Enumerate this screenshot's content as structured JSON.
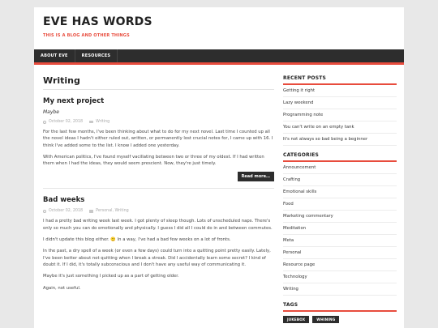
{
  "site": {
    "title": "EVE HAS WORDS",
    "description": "THIS IS A BLOG AND OTHER THINGS"
  },
  "nav": {
    "items": [
      {
        "label": "ABOUT EVE"
      },
      {
        "label": "RESOURCES"
      }
    ]
  },
  "main": {
    "page_title": "Writing",
    "posts": [
      {
        "title": "My next project",
        "subtitle": "Maybe",
        "date": "October 02, 2018",
        "category": "Writing",
        "paragraphs": [
          "For the last few months, I've been thinking about what to do for my next novel. Last time I counted up all the novel ideas I hadn't either ruled out, written, or permanently lost crucial notes for, I came up with 16. I think I've added some to the list. I know I added one yesterday.",
          "With American politics, I've found myself vacillating between two or three of my oldest. If I had written them when I had the ideas, they would seem prescient. Now, they're just timely."
        ],
        "read_more": "Read more…"
      },
      {
        "title": "Bad weeks",
        "date": "October 02, 2018",
        "category": "Personal, Writing",
        "paragraphs": [
          "I had a pretty bad writing week last week. I got plenty of sleep though. Lots of unscheduled naps. There's only so much you can do emotionally and physically. I guess I did all I could do in and between commutes.",
          "I didn't update this blog either. 🙁 In a way, I've had a bad few weeks on a lot of fronts.",
          "In the past, a dry spell of a week (or even a few days) could turn into a quitting point pretty easily. Lately, I've been better about not quitting when I break a streak. Did I accidentally learn some secret? I kind of doubt it. If I did, it's totally subconscious and I don't have any useful way of communicating it.",
          "Maybe it's just something I picked up as a part of getting older.",
          "Again, not useful."
        ]
      }
    ]
  },
  "sidebar": {
    "recent_posts": {
      "title": "RECENT POSTS",
      "items": [
        "Getting it right",
        "Lazy weekend",
        "Programming note",
        "You can't write on an empty tank",
        "It's not always so bad being a beginner"
      ]
    },
    "categories": {
      "title": "CATEGORIES",
      "items": [
        "Announcement",
        "Crafting",
        "Emotional skills",
        "Food",
        "Marketing commentary",
        "Meditation",
        "Meta",
        "Personal",
        "Resource page",
        "Technology",
        "Writing"
      ]
    },
    "tags": {
      "title": "TAGS",
      "items": [
        "JUKEBOX",
        "WHINING"
      ]
    }
  }
}
